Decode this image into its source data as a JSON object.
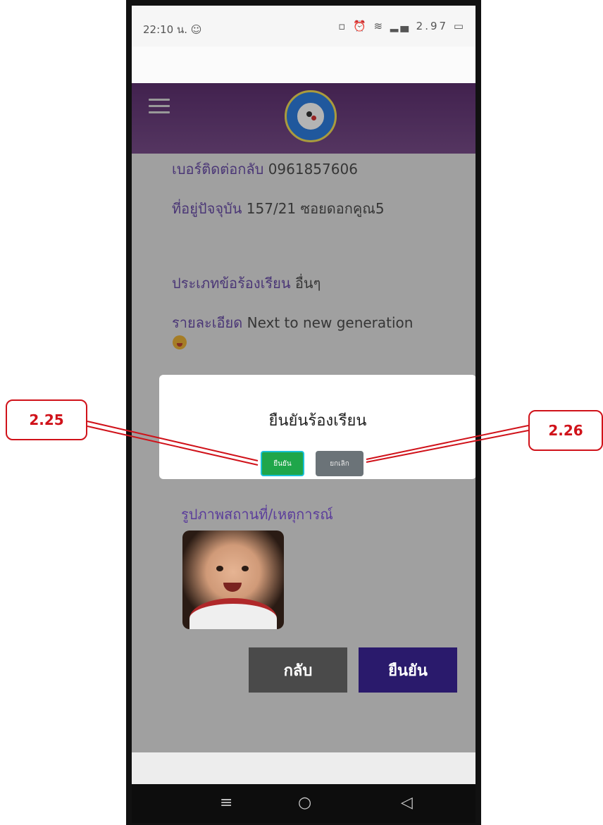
{
  "status_bar": {
    "time": "22:10 น. ☺",
    "icons": "▫ ⏰ ≋ ▂▄ 2.97 ▭"
  },
  "app_bar": {
    "menu_icon": "hamburger-icon",
    "logo": "school-seal-logo"
  },
  "form": {
    "phone_label": "เบอร์ติดต่อกลับ",
    "phone_value": "0961857606",
    "address_label": "ที่อยู่ปัจจุบัน",
    "address_value": "157/21 ซอยดอกคูณ5",
    "type_label": "ประเภทข้อร้องเรียน",
    "type_value": "อื่นๆ",
    "detail_label": "รายละเอียด",
    "detail_value": "Next to new generation",
    "detail_emoji_icon": "tongue-out-emoji-icon",
    "photo_label": "รูปภาพสถานที่/เหตุการณ์"
  },
  "buttons": {
    "back": "กลับ",
    "confirm": "ยืนยัน"
  },
  "dialog": {
    "title": "ยืนยันร้องเรียน",
    "ok": "ยืนยัน",
    "cancel": "ยกเลิก"
  },
  "callouts": {
    "left": "2.25",
    "right": "2.26"
  },
  "nav_bar": {
    "menu": "≡",
    "home": "○",
    "back": "◁"
  },
  "colors": {
    "app_bar": "#4e1f61",
    "label_purple": "#5b3d9b",
    "confirm_button": "#2a1a6c",
    "back_button": "#4a4a4a",
    "dialog_ok": "#1fa64a",
    "dialog_cancel": "#6b7378",
    "callout_red": "#d0121a"
  }
}
